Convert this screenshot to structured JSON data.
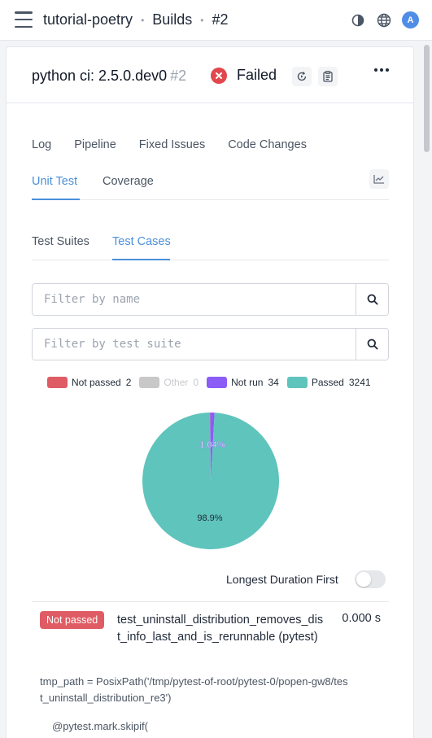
{
  "header": {
    "breadcrumb": [
      {
        "label": "tutorial-poetry"
      },
      {
        "label": "Builds"
      },
      {
        "label": "#2"
      }
    ],
    "avatar_initial": "A",
    "icons": [
      "menu-icon",
      "theme-toggle-icon",
      "globe-icon"
    ]
  },
  "build": {
    "title": "python ci: 2.5.0.dev0",
    "number": "#2",
    "status": "Failed"
  },
  "tabs": {
    "main": [
      "Log",
      "Pipeline",
      "Fixed Issues",
      "Code Changes"
    ],
    "test": [
      {
        "label": "Unit Test",
        "active": true
      },
      {
        "label": "Coverage",
        "active": false
      }
    ],
    "view": [
      {
        "label": "Test Suites",
        "active": false
      },
      {
        "label": "Test Cases",
        "active": true
      }
    ]
  },
  "filters": {
    "name_placeholder": "Filter by name",
    "suite_placeholder": "Filter by test suite"
  },
  "legend": [
    {
      "label": "Not passed",
      "count": "2",
      "color": "#e05c64",
      "enabled": true
    },
    {
      "label": "Other",
      "count": "0",
      "color": "#c8c8c8",
      "enabled": false
    },
    {
      "label": "Not run",
      "count": "34",
      "color": "#8b5cf6",
      "enabled": true
    },
    {
      "label": "Passed",
      "count": "3241",
      "color": "#5fc4bc",
      "enabled": true
    }
  ],
  "chart_data": {
    "type": "pie",
    "slices": [
      {
        "label": "Not passed",
        "value": 2,
        "color": "#e05c64"
      },
      {
        "label": "Not run",
        "value": 34,
        "color": "#8b5cf6"
      },
      {
        "label": "Passed",
        "value": 3241,
        "color": "#5fc4bc"
      }
    ],
    "data_labels": [
      "1.04%",
      "98.9%"
    ]
  },
  "sort": {
    "label": "Longest Duration First",
    "enabled": false
  },
  "result": {
    "badge": "Not passed",
    "name": "test_uninstall_distribution_removes_dist_info_last_and_is_rerunnable (pytest)",
    "duration": "0.000 s",
    "trace": "tmp_path = PosixPath('/tmp/pytest-of-root/pytest-0/popen-gw8/test_uninstall_distribution_re3')",
    "code": "@pytest.mark.skipif("
  }
}
